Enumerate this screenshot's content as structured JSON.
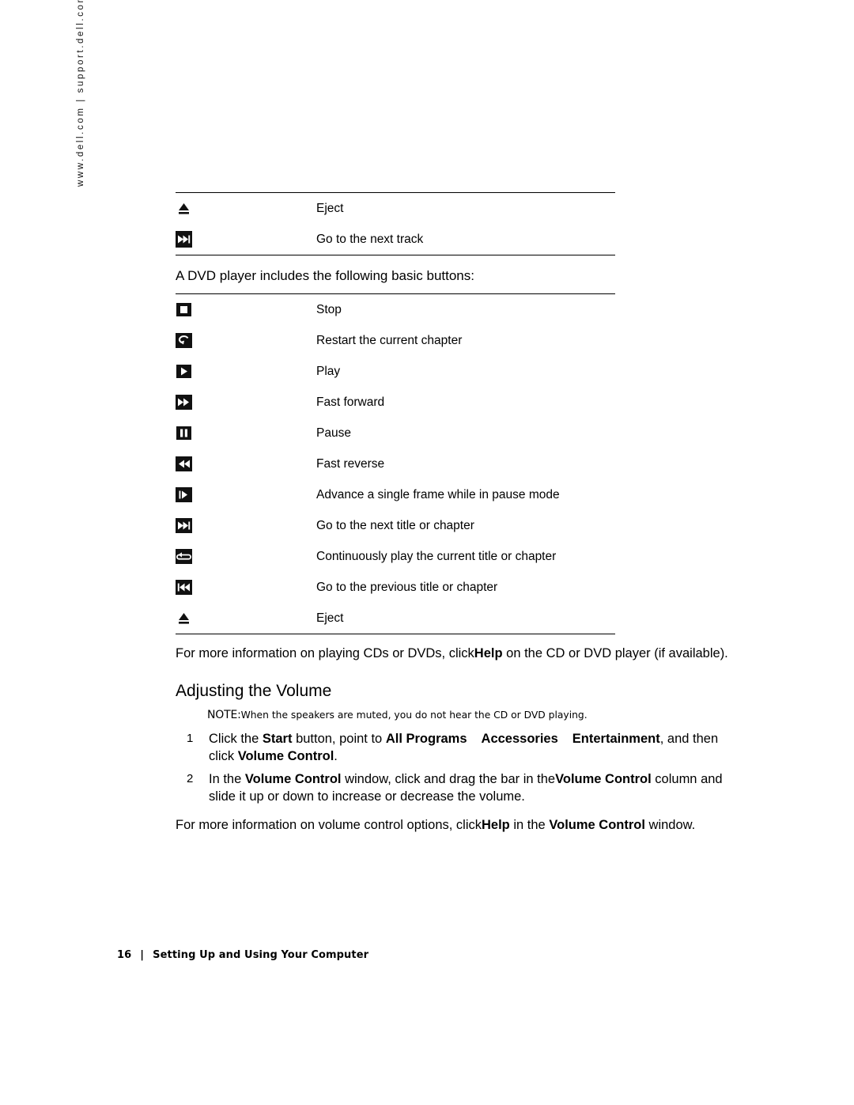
{
  "side_url": "www.dell.com | support.dell.com",
  "cd_buttons_tail": [
    {
      "icon": "eject-icon",
      "desc": "Eject"
    },
    {
      "icon": "next-track-icon",
      "desc": "Go to the next track"
    }
  ],
  "dvd_intro": "A DVD player includes the following basic buttons:",
  "dvd_buttons": [
    {
      "icon": "stop-icon",
      "desc": "Stop"
    },
    {
      "icon": "restart-chapter-icon",
      "desc": "Restart the current chapter"
    },
    {
      "icon": "play-icon",
      "desc": "Play"
    },
    {
      "icon": "fast-forward-icon",
      "desc": "Fast forward"
    },
    {
      "icon": "pause-icon",
      "desc": "Pause"
    },
    {
      "icon": "fast-reverse-icon",
      "desc": "Fast reverse"
    },
    {
      "icon": "frame-advance-icon",
      "desc": "Advance a single frame while in pause mode"
    },
    {
      "icon": "next-title-icon",
      "desc": "Go to the next title or chapter"
    },
    {
      "icon": "repeat-icon",
      "desc": "Continuously play the current title or chapter"
    },
    {
      "icon": "previous-title-icon",
      "desc": "Go to the previous title or chapter"
    },
    {
      "icon": "eject-icon",
      "desc": "Eject"
    }
  ],
  "more_info_cd": {
    "part1": "For more information on playing CDs or DVDs, click",
    "bold": "Help",
    "part2": "on the CD or DVD player (if available)."
  },
  "section_title": "Adjusting the Volume",
  "note": {
    "label": "NOTE:",
    "text": "When the speakers are muted, you do not hear the CD or DVD playing."
  },
  "steps": [
    {
      "num": "1",
      "t1": "Click the",
      "b1": "Start",
      "t2": "button, point to",
      "b2": "All Programs",
      "b3": "Accessories",
      "b4": "Entertainment",
      "t3": ", and then click",
      "b5": "Volume Control",
      "t4": "."
    },
    {
      "num": "2",
      "t1": "In the",
      "b1": "Volume Control",
      "t2": "window, click and drag the bar in the",
      "b2": "Volume Control",
      "t3": "column and slide it up or down to increase or decrease the volume."
    }
  ],
  "more_info_volume": {
    "part1": "For more information on volume control options, click",
    "bold1": "Help",
    "part2": "in the",
    "bold2": "Volume Control",
    "part3": "window."
  },
  "footer": {
    "page": "16",
    "separator": "|",
    "title": "Setting Up and Using Your Computer"
  }
}
